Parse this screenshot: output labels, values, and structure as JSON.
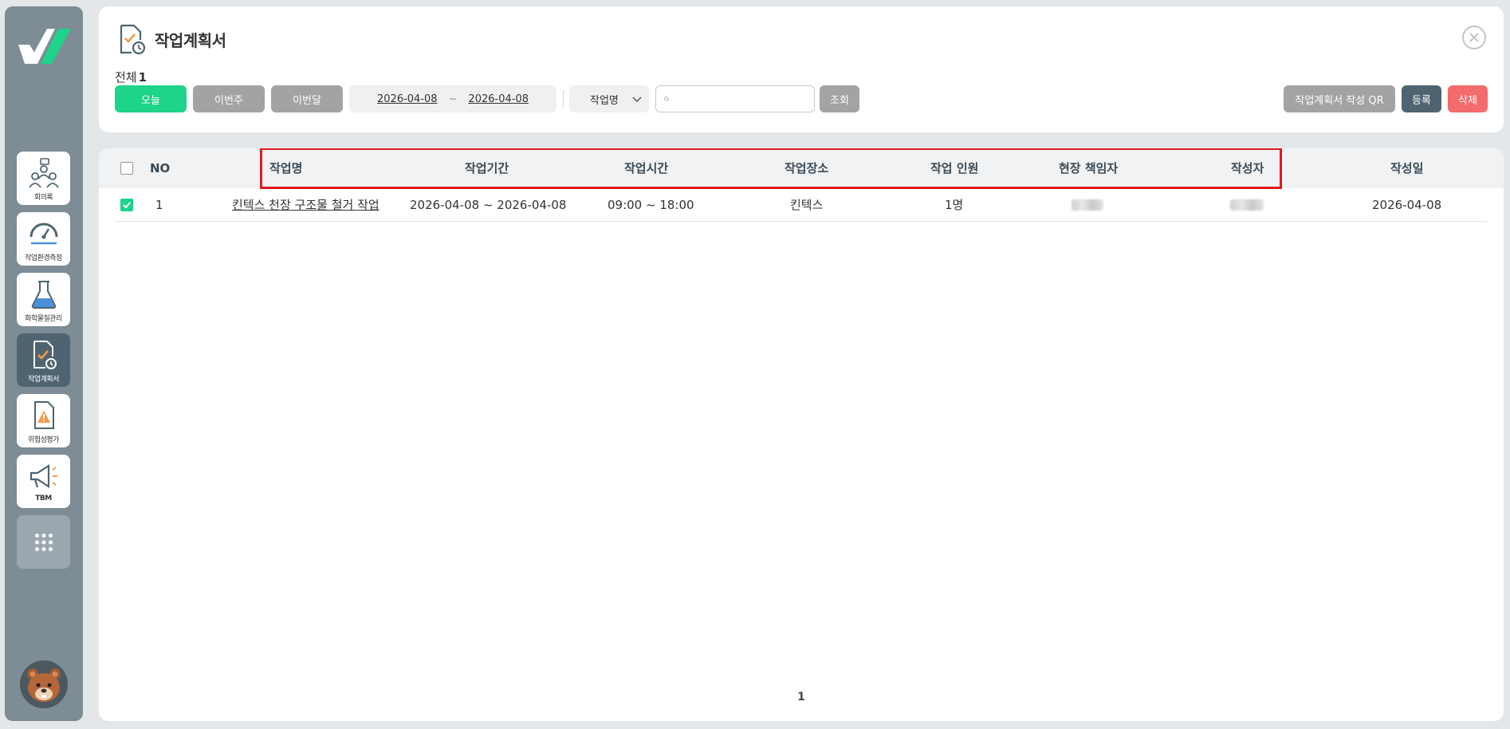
{
  "sidebar": {
    "items": [
      {
        "label": "회의록"
      },
      {
        "label": "작업환경측정"
      },
      {
        "label": "화학물질관리"
      },
      {
        "label": "작업계획서"
      },
      {
        "label": "위험성평가"
      },
      {
        "label": "TBM"
      }
    ]
  },
  "header": {
    "title": "작업계획서",
    "total_label": "전체",
    "total_count": "1"
  },
  "filters": {
    "today_label": "오늘",
    "this_week_label": "이번주",
    "this_month_label": "이번달",
    "date_from": "2026-04-08",
    "date_sep": "~",
    "date_to": "2026-04-08",
    "search_field": "작업명",
    "search_value": "",
    "search_button": "조회"
  },
  "actions": {
    "qr_label": "작업계획서 작성 QR",
    "register_label": "등록",
    "delete_label": "삭제"
  },
  "table": {
    "columns": [
      "NO",
      "작업명",
      "작업기간",
      "작업시간",
      "작업장소",
      "작업 인원",
      "현장 책임자",
      "작성자",
      "작성일"
    ],
    "rows": [
      {
        "checked": true,
        "no": "1",
        "name": "킨텍스 천장 구조물 철거 작업",
        "period": "2026-04-08 ~ 2026-04-08",
        "time": "09:00 ~ 18:00",
        "place": "킨텍스",
        "headcount": "1명",
        "manager": "",
        "author": "",
        "created": "2026-04-08"
      }
    ]
  },
  "pagination": {
    "current": "1"
  },
  "colors": {
    "sidebar_bg": "#7d8c95",
    "active_nav": "#4f6470",
    "accent_green": "#1ed38a",
    "danger_red": "#f46b6b",
    "highlight_border": "#e0181f"
  }
}
